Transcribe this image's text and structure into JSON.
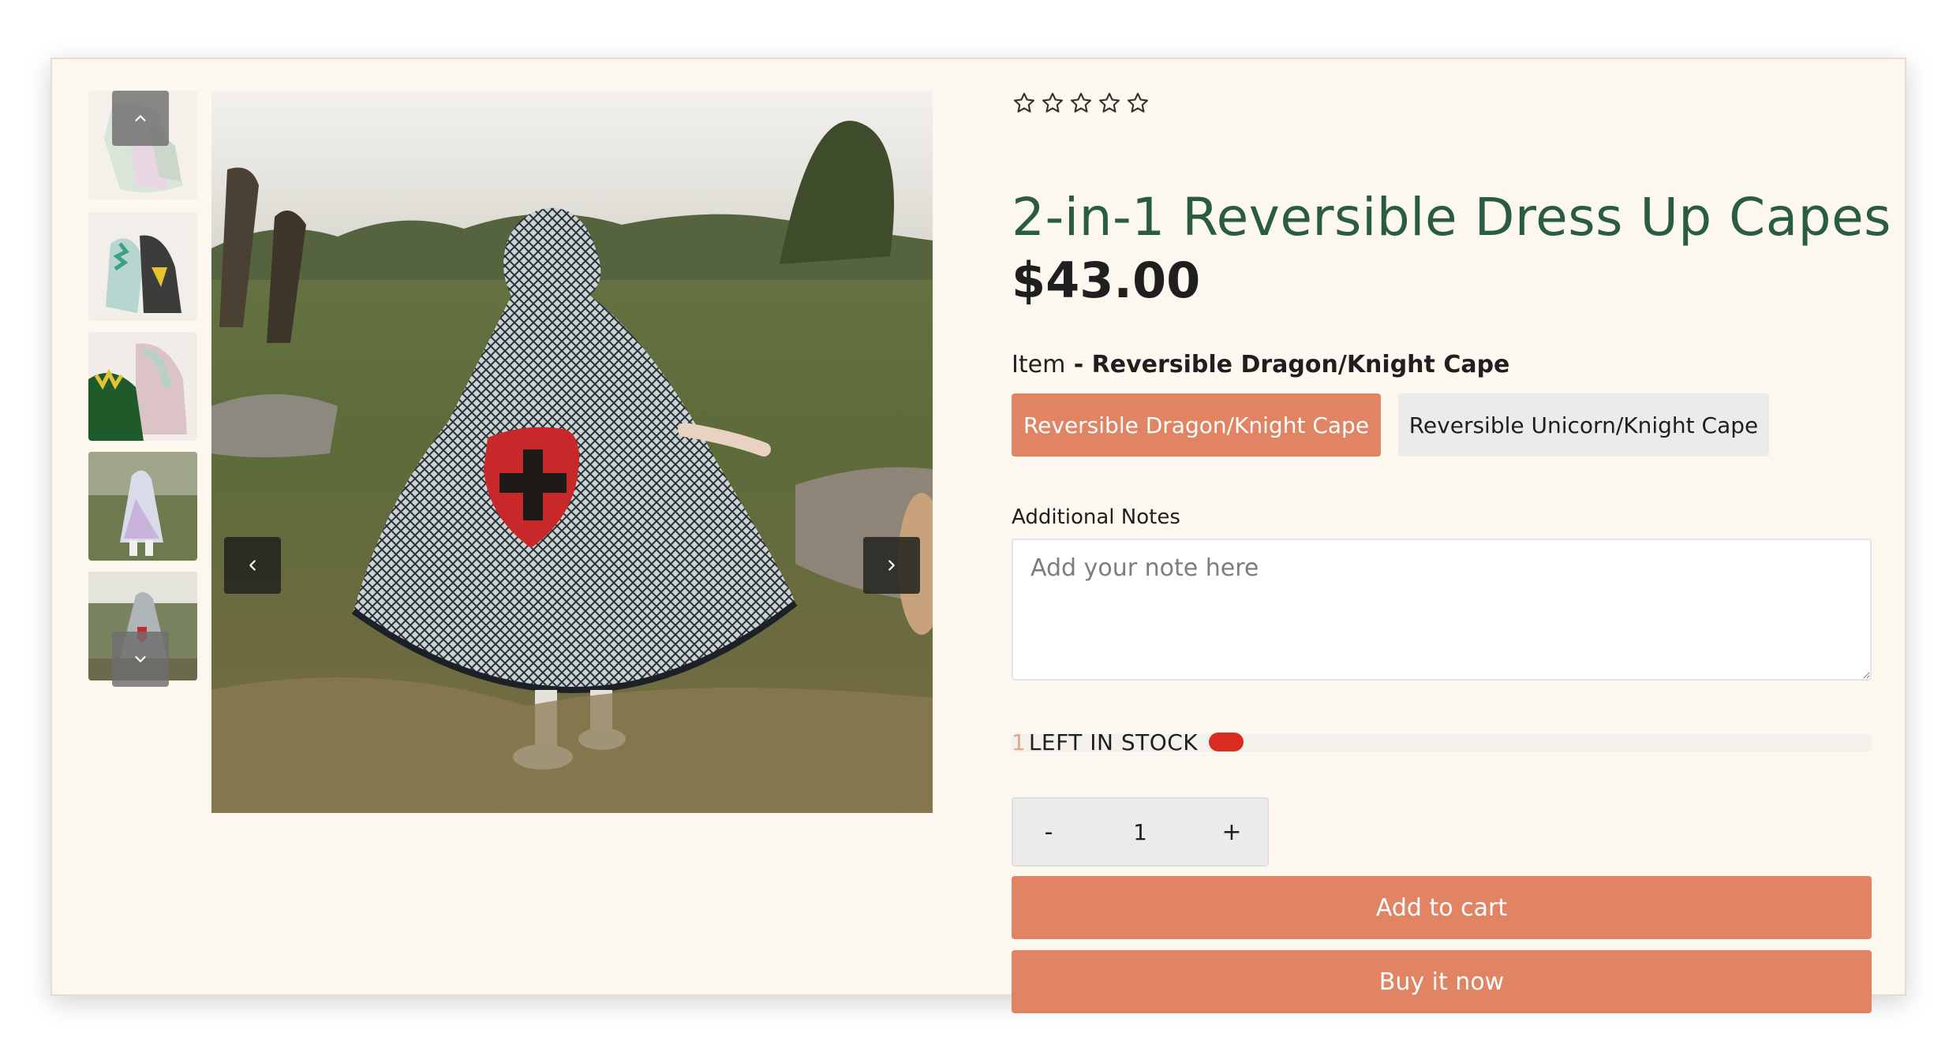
{
  "product": {
    "rating_stars": 5,
    "rating_value": 0,
    "title": "2-in-1 Reversible Dress Up Capes",
    "price": "$43.00"
  },
  "gallery": {
    "thumbnails": [
      {
        "alt": "iridescent-cape-thumbnail"
      },
      {
        "alt": "dragon-cape-thumbnail"
      },
      {
        "alt": "dragon-unicorn-capes-thumbnail"
      },
      {
        "alt": "child-unicorn-cape-thumbnail"
      },
      {
        "alt": "child-knight-cape-thumbnail"
      }
    ],
    "main_image_alt": "child-wearing-knight-cape-in-field"
  },
  "variant": {
    "label": "Item",
    "selected_prefix": " - ",
    "selected_value": "Reversible Dragon/Knight Cape",
    "options": [
      {
        "label": "Reversible Dragon/Knight Cape",
        "selected": true
      },
      {
        "label": "Reversible Unicorn/Knight Cape",
        "selected": false
      }
    ]
  },
  "notes": {
    "label": "Additional Notes",
    "placeholder": "Add your note here",
    "value": ""
  },
  "stock": {
    "count": "1",
    "text": "LEFT IN STOCK"
  },
  "quantity": {
    "minus": "-",
    "value": "1",
    "plus": "+"
  },
  "actions": {
    "add_to_cart": "Add to cart",
    "buy_now": "Buy it now"
  },
  "colors": {
    "title": "#2a5c3e",
    "accent": "#e08463",
    "stock_indicator": "#d92b1f",
    "background": "#fcf8ef"
  },
  "icons": {
    "thumb_up": "chevron-up-icon",
    "thumb_down": "chevron-down-icon",
    "prev": "chevron-left-icon",
    "next": "chevron-right-icon",
    "star": "star-outline-icon"
  }
}
